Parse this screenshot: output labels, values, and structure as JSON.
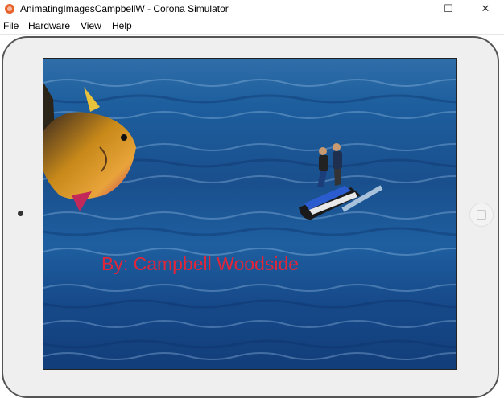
{
  "window": {
    "title": "AnimatingImagesCampbellW - Corona Simulator",
    "minimize_glyph": "—",
    "maximize_glyph": "☐",
    "close_glyph": "✕"
  },
  "menu": {
    "items": [
      "File",
      "Hardware",
      "View",
      "Help"
    ]
  },
  "screen": {
    "credit_text": "By: Campbell Woodside"
  },
  "colors": {
    "credit": "#e2263a",
    "water": "#1d5e9e",
    "device_bezel": "#efefef"
  },
  "icons": [
    "corona-app-icon",
    "camera-dot",
    "home-button",
    "fish-sprite",
    "jetski-sprite"
  ]
}
